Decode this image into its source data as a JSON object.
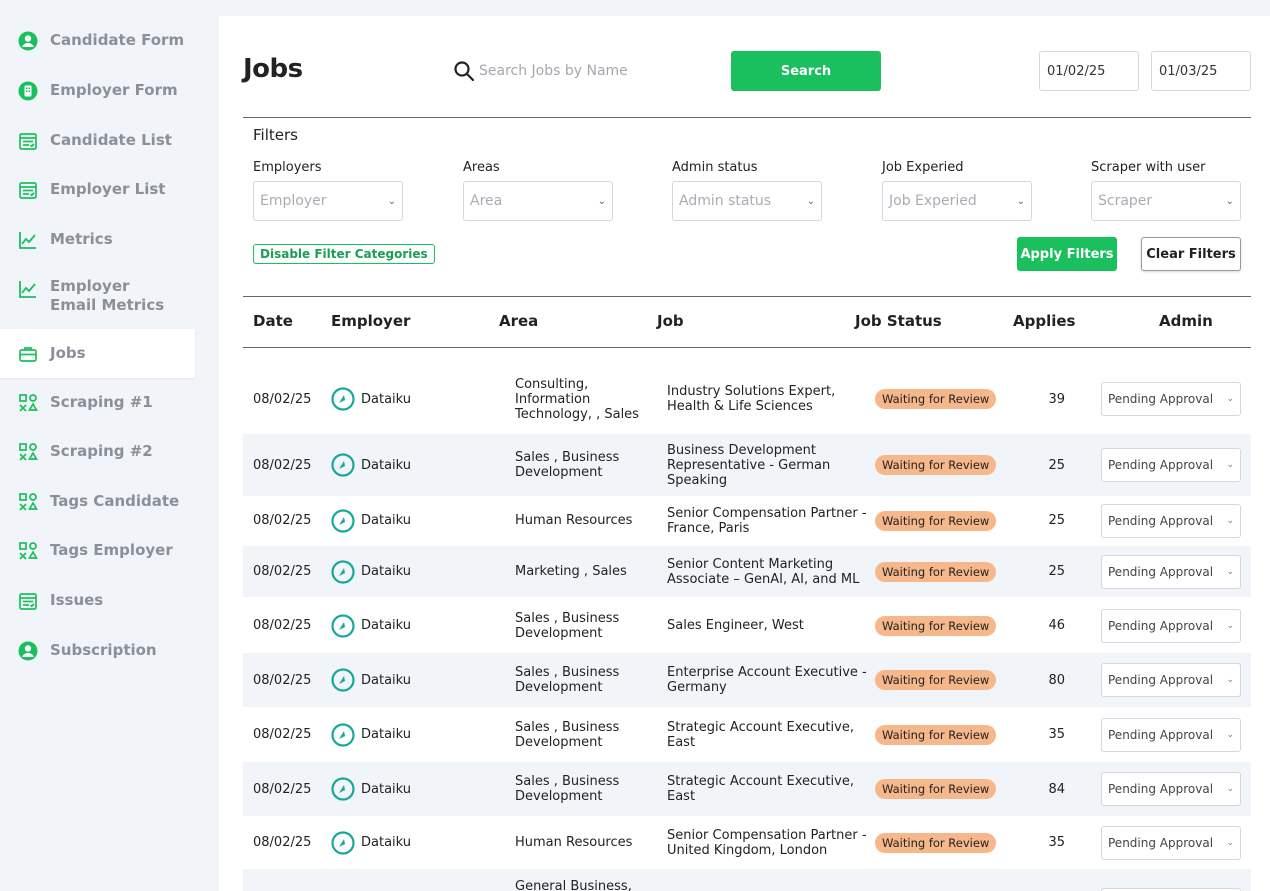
{
  "sidebar": {
    "items": [
      {
        "label": "Candidate Form",
        "icon": "user-circle-icon"
      },
      {
        "label": "Employer Form",
        "icon": "building-icon"
      },
      {
        "label": "Candidate List",
        "icon": "list-check-icon"
      },
      {
        "label": "Employer List",
        "icon": "list-check-icon"
      },
      {
        "label": "Metrics",
        "icon": "line-chart-icon"
      },
      {
        "label": "Employer Email Metrics",
        "icon": "line-chart-icon"
      },
      {
        "label": "Jobs",
        "icon": "briefcase-icon",
        "active": true
      },
      {
        "label": "Scraping #1",
        "icon": "shapes-icon"
      },
      {
        "label": "Scraping #2",
        "icon": "shapes-icon"
      },
      {
        "label": "Tags Candidate",
        "icon": "shapes-icon"
      },
      {
        "label": "Tags Employer",
        "icon": "shapes-icon"
      },
      {
        "label": "Issues",
        "icon": "list-check-icon"
      },
      {
        "label": "Subscription",
        "icon": "user-circle-icon"
      }
    ]
  },
  "header": {
    "title": "Jobs",
    "search_placeholder": "Search Jobs by Name",
    "search_button": "Search",
    "date_from": "01/02/25",
    "date_to": "01/03/25"
  },
  "filters": {
    "title": "Filters",
    "fields": [
      {
        "label": "Employers",
        "placeholder": "Employer"
      },
      {
        "label": "Areas",
        "placeholder": "Area"
      },
      {
        "label": "Admin status",
        "placeholder": "Admin status"
      },
      {
        "label": "Job Experied",
        "placeholder": "Job Experied"
      },
      {
        "label": "Scraper with user",
        "placeholder": "Scraper"
      }
    ],
    "disable_label": "Disable Filter Categories",
    "apply_label": "Apply Filters",
    "clear_label": "Clear Filters"
  },
  "table": {
    "headers": {
      "date": "Date",
      "employer": "Employer",
      "area": "Area",
      "job": "Job",
      "status": "Job Status",
      "applies": "Applies",
      "admin": "Admin"
    },
    "rows": [
      {
        "date": "08/02/25",
        "employer": "Dataiku",
        "area": "Consulting, Information Technology, , Sales",
        "job": "Industry Solutions Expert, Health & Life Sciences",
        "status": "Waiting for Review",
        "applies": "39",
        "admin": "Pending Approval"
      },
      {
        "date": "08/02/25",
        "employer": "Dataiku",
        "area": "Sales , Business Development",
        "job": "Business Development Representative - German Speaking",
        "status": "Waiting for Review",
        "applies": "25",
        "admin": "Pending Approval"
      },
      {
        "date": "08/02/25",
        "employer": "Dataiku",
        "area": "Human Resources",
        "job": "Senior Compensation Partner - France, Paris",
        "status": "Waiting for Review",
        "applies": "25",
        "admin": "Pending Approval"
      },
      {
        "date": "08/02/25",
        "employer": "Dataiku",
        "area": "Marketing , Sales",
        "job": "Senior Content Marketing Associate – GenAI, AI, and ML",
        "status": "Waiting for Review",
        "applies": "25",
        "admin": "Pending Approval"
      },
      {
        "date": "08/02/25",
        "employer": "Dataiku",
        "area": "Sales , Business Development",
        "job": "Sales Engineer, West",
        "status": "Waiting for Review",
        "applies": "46",
        "admin": "Pending Approval"
      },
      {
        "date": "08/02/25",
        "employer": "Dataiku",
        "area": "Sales , Business Development",
        "job": "Enterprise Account Executive - Germany",
        "status": "Waiting for Review",
        "applies": "80",
        "admin": "Pending Approval"
      },
      {
        "date": "08/02/25",
        "employer": "Dataiku",
        "area": "Sales , Business Development",
        "job": "Strategic Account Executive, East",
        "status": "Waiting for Review",
        "applies": "35",
        "admin": "Pending Approval"
      },
      {
        "date": "08/02/25",
        "employer": "Dataiku",
        "area": "Sales , Business Development",
        "job": "Strategic Account Executive, East",
        "status": "Waiting for Review",
        "applies": "84",
        "admin": "Pending Approval"
      },
      {
        "date": "08/02/25",
        "employer": "Dataiku",
        "area": "Human Resources",
        "job": "Senior Compensation Partner - United Kingdom, London",
        "status": "Waiting for Review",
        "applies": "35",
        "admin": "Pending Approval"
      },
      {
        "date": "",
        "employer": "",
        "area": "General Business,",
        "job": "",
        "status": "",
        "applies": "",
        "admin": ""
      }
    ]
  },
  "colors": {
    "accent": "#1ac05d",
    "badge": "#f6b78b",
    "employer_logo": "#17a89a",
    "background": "#f1f4f8"
  }
}
